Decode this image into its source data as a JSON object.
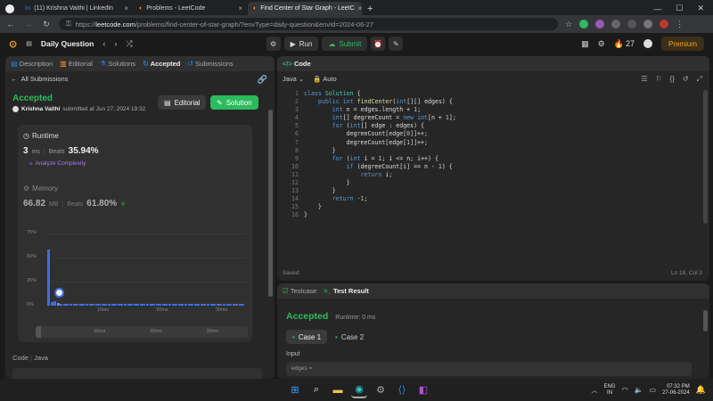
{
  "browser": {
    "tabs": [
      {
        "label": "(11) Krishna Vaithi | LinkedIn",
        "icon": "linkedin-icon",
        "active": false
      },
      {
        "label": "Problems - LeetCode",
        "icon": "leetcode-icon",
        "active": false
      },
      {
        "label": "Find Center of Star Graph - LeetC",
        "icon": "leetcode-icon",
        "active": true
      }
    ],
    "url_host": "leetcode.com",
    "url_path": "/problems/find-center-of-star-graph/?envType=daily-question&envId=2024-06-27",
    "url_scheme": "https://"
  },
  "header": {
    "title": "Daily Question",
    "run_label": "Run",
    "submit_label": "Submit",
    "streak": "27",
    "premium_label": "Premium"
  },
  "left": {
    "tabs": [
      "Description",
      "Editorial",
      "Solutions",
      "Accepted",
      "Submissions"
    ],
    "back_label": "All Submissions",
    "status": "Accepted",
    "user": "Krishna Vaithi",
    "submitted_at": "submitted at Jun 27, 2024 19:32",
    "editorial_btn": "Editorial",
    "solution_btn": "Solution",
    "runtime_title": "Runtime",
    "runtime_value": "3",
    "runtime_unit": "ms",
    "beats_label": "Beats",
    "runtime_beats": "35.94%",
    "analyze_label": "Analyze Complexity",
    "memory_title": "Memory",
    "memory_value": "66.82",
    "memory_unit": "MB",
    "memory_beats": "61.80%",
    "code_label": "Code",
    "lang_label": "Java"
  },
  "chart_data": {
    "type": "bar",
    "y_ticks": [
      "75%",
      "50%",
      "25%",
      "0%"
    ],
    "x_ticks": [
      "10ms",
      "20ms",
      "30ms"
    ],
    "ylim": [
      0,
      75
    ],
    "values": [
      58,
      4,
      5,
      3,
      2,
      2,
      2,
      2,
      2,
      2,
      2,
      2,
      2,
      2,
      2,
      2,
      2,
      2,
      2,
      2,
      2,
      2,
      2,
      2,
      2,
      2,
      2,
      2,
      2,
      2,
      2,
      2,
      2,
      2,
      2,
      2,
      2,
      2,
      2,
      2,
      2,
      2,
      2,
      2,
      2,
      2,
      2,
      2,
      2,
      2,
      2,
      2,
      2,
      2,
      2,
      2,
      2,
      2,
      2,
      2,
      2,
      2
    ],
    "highlight_index": 3,
    "mini_ticks": [
      "10ms",
      "20ms",
      "30ms"
    ]
  },
  "code_panel": {
    "title": "Code",
    "language": "Java",
    "mode": "Auto",
    "status": "Saved",
    "cursor": "Ln 16, Col 3",
    "lines": [
      "class Solution {",
      "    public int findCenter(int[][] edges) {",
      "        int n = edges.length + 1;",
      "        int[] degreeCount = new int[n + 1];",
      "        for (int[] edge : edges) {",
      "            degreeCount[edge[0]]++;",
      "            degreeCount[edge[1]]++;",
      "        }",
      "        for (int i = 1; i <= n; i++) {",
      "            if (degreeCount[i] == n - 1) {",
      "                return i;",
      "            }",
      "        }",
      "        return -1;",
      "    }",
      "}"
    ]
  },
  "result_panel": {
    "tab_testcase": "Testcase",
    "tab_result": "Test Result",
    "status": "Accepted",
    "runtime": "Runtime: 0 ms",
    "cases": [
      "Case 1",
      "Case 2"
    ],
    "input_label": "Input",
    "input_value": "edges ="
  },
  "taskbar": {
    "lang": "ENG",
    "region": "IN",
    "time": "07:32 PM",
    "date": "27-06-2024"
  },
  "colors": {
    "accent_green": "#2cbb5d",
    "accent_orange": "#ffa116",
    "bar_blue": "#3c6fe0"
  }
}
